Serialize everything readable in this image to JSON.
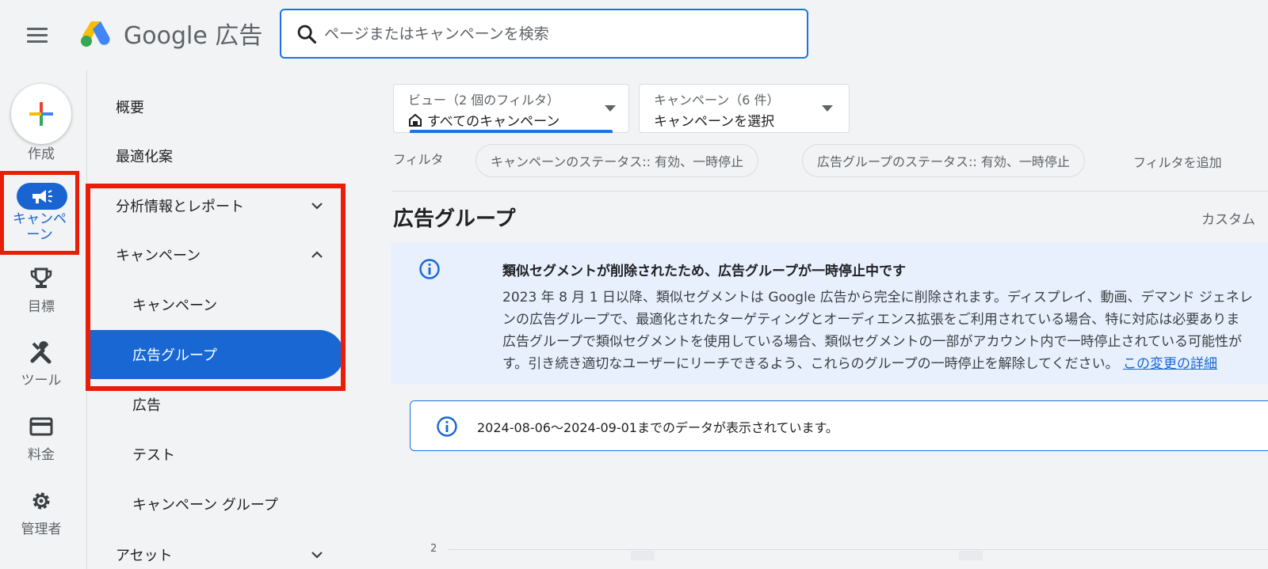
{
  "header": {
    "logo_text": "Google 広告",
    "search_placeholder": "ページまたはキャンペーンを検索"
  },
  "rail": {
    "create_label": "作成",
    "campaign_label_line1": "キャンペ",
    "campaign_label_line2": "ーン",
    "goals_label": "目標",
    "tools_label": "ツール",
    "billing_label": "料金",
    "admin_label": "管理者"
  },
  "nav": {
    "items": [
      {
        "label": "概要"
      },
      {
        "label": "最適化案"
      },
      {
        "label": "分析情報とレポート"
      },
      {
        "label": "キャンペーン"
      },
      {
        "label": "キャンペーン"
      },
      {
        "label": "広告グループ"
      },
      {
        "label": "広告"
      },
      {
        "label": "テスト"
      },
      {
        "label": "キャンペーン グループ"
      },
      {
        "label": "アセット"
      }
    ]
  },
  "main": {
    "view_dropdown": {
      "label": "ビュー（2 個のフィルタ）",
      "value": "すべてのキャンペーン"
    },
    "campaign_dropdown": {
      "label": "キャンペーン（6 件）",
      "value": "キャンペーンを選択"
    },
    "filter_label": "フィルタ",
    "chips": [
      "キャンペーンのステータス:: 有効、一時停止",
      "広告グループのステータス:: 有効、一時停止"
    ],
    "add_filter": "フィルタを追加",
    "page_title": "広告グループ",
    "custom_label": "カスタム",
    "notice": {
      "title": "類似セグメントが削除されたため、広告グループが一時停止中です",
      "line1": "2023 年 8 月 1 日以降、類似セグメントは Google 広告から完全に削除されます。ディスプレイ、動画、デマンド ジェネレ",
      "line2": "ンの広告グループで、最適化されたターゲティングとオーディエンス拡張をご利用されている場合、特に対応は必要ありま",
      "line3": "広告グループで類似セグメントを使用している場合、類似セグメントの一部がアカウント内で一時停止されている可能性が",
      "line4": "す。引き続き適切なユーザーにリーチできるよう、これらのグループの一時停止を解除してください。",
      "link": "この変更の詳細"
    },
    "date_notice": "2024-08-06〜2024-09-01までのデータが表示されています。",
    "chart_tick": "2"
  },
  "colors": {
    "accent": "#1a73e8",
    "active_nav": "#1967d2",
    "highlight_border": "#ea1c0a"
  }
}
